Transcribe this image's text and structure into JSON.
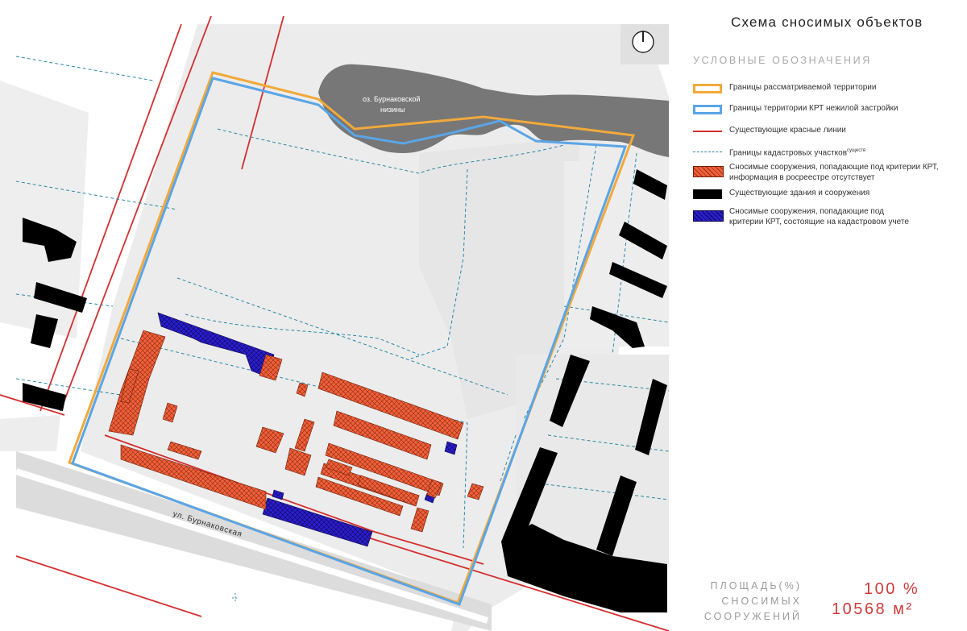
{
  "title": "Схема сносимых объектов",
  "legend": {
    "heading": "УСЛОВНЫЕ ОБОЗНАЧЕНИЯ",
    "items": [
      {
        "key": "study_area",
        "label": "Границы рассматриваемой территории",
        "kind": "outline",
        "color": "#f2a93b"
      },
      {
        "key": "krt_area",
        "label": "Границы территории КРТ нежилой застройки",
        "kind": "outline",
        "color": "#5aa5e6"
      },
      {
        "key": "red_lines",
        "label": "Существующие красные линии",
        "kind": "line",
        "color": "#d32f2f"
      },
      {
        "key": "cadastral",
        "label": "Границы кадастровых участков",
        "label_sup": "существ",
        "kind": "dash",
        "color": "#2b8aa8"
      },
      {
        "key": "demolish_krt_unregistered",
        "label": "Сносимые сооружения, попадающие под критерии КРТ,\nинформация в росреестре отсутствует",
        "kind": "hatch",
        "color": "#f0603a"
      },
      {
        "key": "existing_buildings",
        "label": "Существующие здания и сооружения",
        "kind": "fill",
        "color": "#000000"
      },
      {
        "key": "demolish_krt_registered",
        "label": "Сносимые сооружения, попадающие под\nкритерии КРТ, состоящие на кадастровом учете",
        "kind": "hatch",
        "color": "#2b1ec9"
      }
    ]
  },
  "map": {
    "lake_label_line1": "оз. Бурнаковской",
    "lake_label_line2": "низины",
    "street_label": "ул. Бурнаковская",
    "north_arrow_icon": "north-arrow-icon"
  },
  "stats": {
    "label": "ПЛОЩАДЬ(%)\nСНОСИМЫХ\nСООРУЖЕНИЙ",
    "percent": "100 %",
    "area": "10568 м²"
  }
}
